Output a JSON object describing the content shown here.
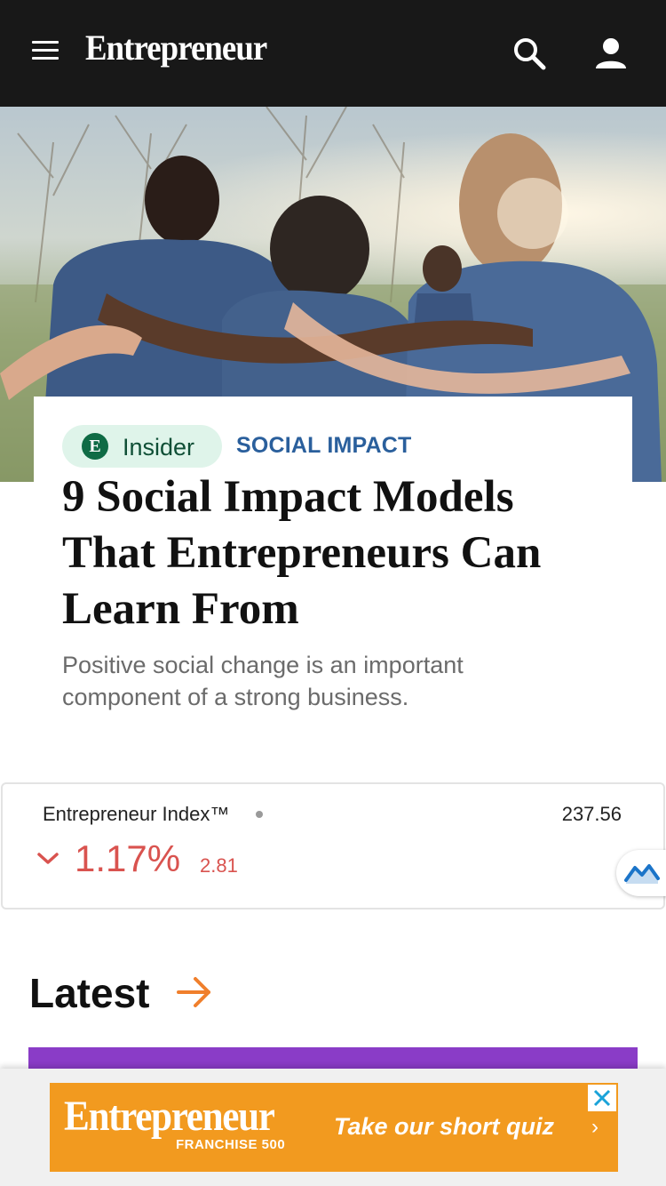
{
  "header": {
    "logo_text": "Entrepreneur",
    "icons": [
      "menu-icon",
      "search-icon",
      "user-icon"
    ],
    "background": "#181818"
  },
  "hero": {
    "image": "group-of-volunteers-embracing-photo",
    "badge_label": "Insider",
    "badge_mark": "E",
    "category": "SOCIAL IMPACT",
    "headline": "9 Social Impact Models That Entrepreneurs Can Learn From",
    "dek": "Positive social change is an important component of a strong business."
  },
  "index_widget": {
    "name": "Entrepreneur Index™",
    "value": "237.56",
    "change_percent": "1.17%",
    "change_points": "2.81",
    "direction": "down",
    "negative_color": "#d9534f"
  },
  "latest": {
    "title": "Latest",
    "accent_color": "#f07f2c"
  },
  "ad": {
    "logo_text": "Entrepreneur",
    "sub_text": "FRANCHISE 500",
    "cta": "Take our short quiz",
    "chevron": "›",
    "background": "#f29a1f",
    "close_color": "#1aa3d9"
  }
}
